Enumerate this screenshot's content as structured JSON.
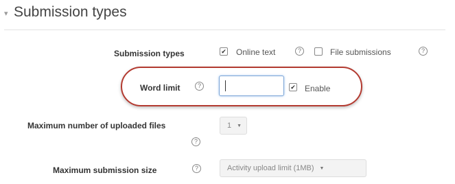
{
  "section": {
    "title": "Submission types",
    "collapse_icon": "▾"
  },
  "submission_types": {
    "label": "Submission types",
    "online_text": {
      "label": "Online text",
      "checked": true
    },
    "file_submissions": {
      "label": "File submissions",
      "checked": false
    }
  },
  "word_limit": {
    "label": "Word limit",
    "value": "",
    "enable_label": "Enable",
    "enabled": true
  },
  "max_files": {
    "label": "Maximum number of uploaded files",
    "value": "1"
  },
  "max_size": {
    "label": "Maximum submission size",
    "value": "Activity upload limit (1MB)"
  },
  "icons": {
    "help": "?",
    "check": "✔",
    "dropdown": "▼"
  },
  "colors": {
    "highlight_ring": "#b33a30",
    "input_focus_border": "#7aa4d6"
  }
}
